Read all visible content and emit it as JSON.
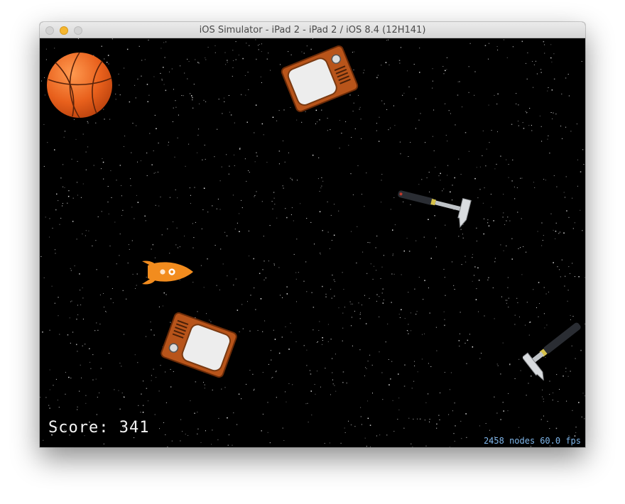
{
  "window": {
    "title": "iOS Simulator - iPad 2 - iPad 2 / iOS 8.4 (12H141)"
  },
  "hud": {
    "score": "Score: 341",
    "node_count": "2458 nodes",
    "fps": "60.0 fps"
  },
  "sprites": [
    "basketball-icon",
    "tv-icon",
    "hammer-icon",
    "rocket-icon",
    "tv-icon",
    "hammer-icon"
  ],
  "colors": {
    "background": "#000000",
    "score_text": "#f4f4f4",
    "stats_text": "#7fb6ea",
    "rocket": "#f28c1e",
    "tv_body": "#b8541a"
  }
}
